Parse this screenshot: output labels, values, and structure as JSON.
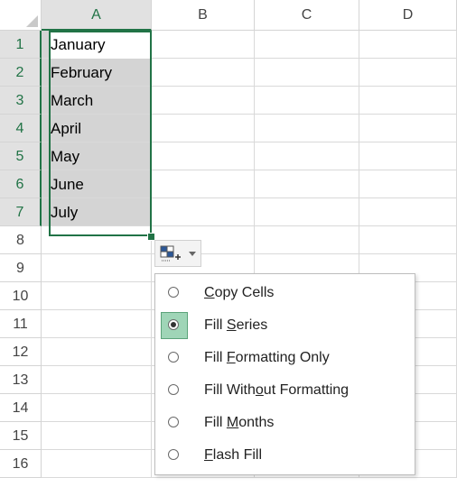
{
  "columns": [
    "A",
    "B",
    "C",
    "D"
  ],
  "rows": [
    "1",
    "2",
    "3",
    "4",
    "5",
    "6",
    "7",
    "8",
    "9",
    "10",
    "11",
    "12",
    "13",
    "14",
    "15",
    "16"
  ],
  "cells": {
    "A1": "January",
    "A2": "February",
    "A3": "March",
    "A4": "April",
    "A5": "May",
    "A6": "June",
    "A7": "July"
  },
  "autofill_options": {
    "icon": "auto-fill-options-icon",
    "items": [
      {
        "pre": "",
        "key": "C",
        "post": "opy Cells",
        "checked": false
      },
      {
        "pre": "Fill ",
        "key": "S",
        "post": "eries",
        "checked": true
      },
      {
        "pre": "Fill ",
        "key": "F",
        "post": "ormatting Only",
        "checked": false
      },
      {
        "pre": "Fill With",
        "key": "o",
        "post": "ut Formatting",
        "checked": false
      },
      {
        "pre": "Fill ",
        "key": "M",
        "post": "onths",
        "checked": false
      },
      {
        "pre": "",
        "key": "F",
        "post": "lash Fill",
        "checked": false
      }
    ]
  },
  "colors": {
    "accent": "#217346",
    "selection_fill": "#d4d4d4",
    "checked_option": "#9fd5b7"
  }
}
